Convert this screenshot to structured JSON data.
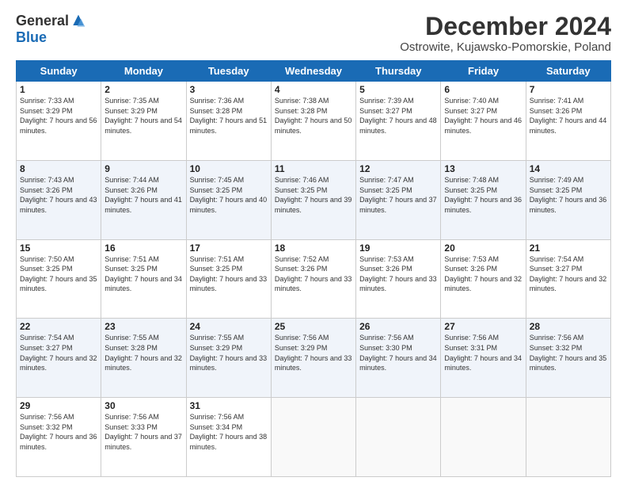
{
  "logo": {
    "general": "General",
    "blue": "Blue"
  },
  "title": "December 2024",
  "subtitle": "Ostrowite, Kujawsko-Pomorskie, Poland",
  "days_header": [
    "Sunday",
    "Monday",
    "Tuesday",
    "Wednesday",
    "Thursday",
    "Friday",
    "Saturday"
  ],
  "weeks": [
    [
      {
        "day": "1",
        "sunrise": "Sunrise: 7:33 AM",
        "sunset": "Sunset: 3:29 PM",
        "daylight": "Daylight: 7 hours and 56 minutes."
      },
      {
        "day": "2",
        "sunrise": "Sunrise: 7:35 AM",
        "sunset": "Sunset: 3:29 PM",
        "daylight": "Daylight: 7 hours and 54 minutes."
      },
      {
        "day": "3",
        "sunrise": "Sunrise: 7:36 AM",
        "sunset": "Sunset: 3:28 PM",
        "daylight": "Daylight: 7 hours and 51 minutes."
      },
      {
        "day": "4",
        "sunrise": "Sunrise: 7:38 AM",
        "sunset": "Sunset: 3:28 PM",
        "daylight": "Daylight: 7 hours and 50 minutes."
      },
      {
        "day": "5",
        "sunrise": "Sunrise: 7:39 AM",
        "sunset": "Sunset: 3:27 PM",
        "daylight": "Daylight: 7 hours and 48 minutes."
      },
      {
        "day": "6",
        "sunrise": "Sunrise: 7:40 AM",
        "sunset": "Sunset: 3:27 PM",
        "daylight": "Daylight: 7 hours and 46 minutes."
      },
      {
        "day": "7",
        "sunrise": "Sunrise: 7:41 AM",
        "sunset": "Sunset: 3:26 PM",
        "daylight": "Daylight: 7 hours and 44 minutes."
      }
    ],
    [
      {
        "day": "8",
        "sunrise": "Sunrise: 7:43 AM",
        "sunset": "Sunset: 3:26 PM",
        "daylight": "Daylight: 7 hours and 43 minutes."
      },
      {
        "day": "9",
        "sunrise": "Sunrise: 7:44 AM",
        "sunset": "Sunset: 3:26 PM",
        "daylight": "Daylight: 7 hours and 41 minutes."
      },
      {
        "day": "10",
        "sunrise": "Sunrise: 7:45 AM",
        "sunset": "Sunset: 3:25 PM",
        "daylight": "Daylight: 7 hours and 40 minutes."
      },
      {
        "day": "11",
        "sunrise": "Sunrise: 7:46 AM",
        "sunset": "Sunset: 3:25 PM",
        "daylight": "Daylight: 7 hours and 39 minutes."
      },
      {
        "day": "12",
        "sunrise": "Sunrise: 7:47 AM",
        "sunset": "Sunset: 3:25 PM",
        "daylight": "Daylight: 7 hours and 37 minutes."
      },
      {
        "day": "13",
        "sunrise": "Sunrise: 7:48 AM",
        "sunset": "Sunset: 3:25 PM",
        "daylight": "Daylight: 7 hours and 36 minutes."
      },
      {
        "day": "14",
        "sunrise": "Sunrise: 7:49 AM",
        "sunset": "Sunset: 3:25 PM",
        "daylight": "Daylight: 7 hours and 36 minutes."
      }
    ],
    [
      {
        "day": "15",
        "sunrise": "Sunrise: 7:50 AM",
        "sunset": "Sunset: 3:25 PM",
        "daylight": "Daylight: 7 hours and 35 minutes."
      },
      {
        "day": "16",
        "sunrise": "Sunrise: 7:51 AM",
        "sunset": "Sunset: 3:25 PM",
        "daylight": "Daylight: 7 hours and 34 minutes."
      },
      {
        "day": "17",
        "sunrise": "Sunrise: 7:51 AM",
        "sunset": "Sunset: 3:25 PM",
        "daylight": "Daylight: 7 hours and 33 minutes."
      },
      {
        "day": "18",
        "sunrise": "Sunrise: 7:52 AM",
        "sunset": "Sunset: 3:26 PM",
        "daylight": "Daylight: 7 hours and 33 minutes."
      },
      {
        "day": "19",
        "sunrise": "Sunrise: 7:53 AM",
        "sunset": "Sunset: 3:26 PM",
        "daylight": "Daylight: 7 hours and 33 minutes."
      },
      {
        "day": "20",
        "sunrise": "Sunrise: 7:53 AM",
        "sunset": "Sunset: 3:26 PM",
        "daylight": "Daylight: 7 hours and 32 minutes."
      },
      {
        "day": "21",
        "sunrise": "Sunrise: 7:54 AM",
        "sunset": "Sunset: 3:27 PM",
        "daylight": "Daylight: 7 hours and 32 minutes."
      }
    ],
    [
      {
        "day": "22",
        "sunrise": "Sunrise: 7:54 AM",
        "sunset": "Sunset: 3:27 PM",
        "daylight": "Daylight: 7 hours and 32 minutes."
      },
      {
        "day": "23",
        "sunrise": "Sunrise: 7:55 AM",
        "sunset": "Sunset: 3:28 PM",
        "daylight": "Daylight: 7 hours and 32 minutes."
      },
      {
        "day": "24",
        "sunrise": "Sunrise: 7:55 AM",
        "sunset": "Sunset: 3:29 PM",
        "daylight": "Daylight: 7 hours and 33 minutes."
      },
      {
        "day": "25",
        "sunrise": "Sunrise: 7:56 AM",
        "sunset": "Sunset: 3:29 PM",
        "daylight": "Daylight: 7 hours and 33 minutes."
      },
      {
        "day": "26",
        "sunrise": "Sunrise: 7:56 AM",
        "sunset": "Sunset: 3:30 PM",
        "daylight": "Daylight: 7 hours and 34 minutes."
      },
      {
        "day": "27",
        "sunrise": "Sunrise: 7:56 AM",
        "sunset": "Sunset: 3:31 PM",
        "daylight": "Daylight: 7 hours and 34 minutes."
      },
      {
        "day": "28",
        "sunrise": "Sunrise: 7:56 AM",
        "sunset": "Sunset: 3:32 PM",
        "daylight": "Daylight: 7 hours and 35 minutes."
      }
    ],
    [
      {
        "day": "29",
        "sunrise": "Sunrise: 7:56 AM",
        "sunset": "Sunset: 3:32 PM",
        "daylight": "Daylight: 7 hours and 36 minutes."
      },
      {
        "day": "30",
        "sunrise": "Sunrise: 7:56 AM",
        "sunset": "Sunset: 3:33 PM",
        "daylight": "Daylight: 7 hours and 37 minutes."
      },
      {
        "day": "31",
        "sunrise": "Sunrise: 7:56 AM",
        "sunset": "Sunset: 3:34 PM",
        "daylight": "Daylight: 7 hours and 38 minutes."
      },
      null,
      null,
      null,
      null
    ]
  ]
}
